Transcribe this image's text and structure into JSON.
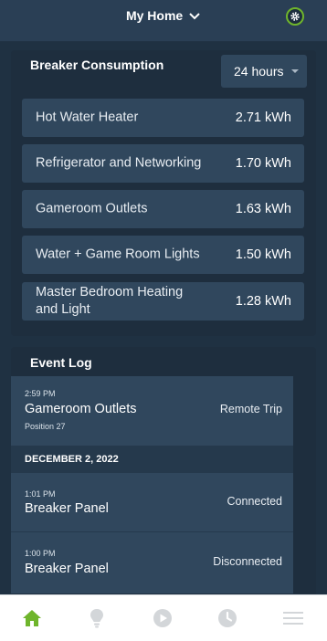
{
  "header": {
    "title": "My Home",
    "title_icon": "chevron-down-icon",
    "settings_icon": "gear-icon"
  },
  "breaker_consumption": {
    "title": "Breaker Consumption",
    "range_selected": "24 hours",
    "rows": [
      {
        "name": "Hot Water Heater",
        "value": "2.71 kWh"
      },
      {
        "name": "Refrigerator and Networking",
        "value": "1.70 kWh"
      },
      {
        "name": "Gameroom Outlets",
        "value": "1.63 kWh"
      },
      {
        "name": "Water + Game Room Lights",
        "value": "1.50 kWh"
      },
      {
        "name": "Master Bedroom Heating and Light",
        "value": "1.28 kWh"
      }
    ]
  },
  "event_log": {
    "title": "Event Log",
    "first_event": {
      "time": "2:59 PM",
      "name": "Gameroom Outlets",
      "sub": "Position 27",
      "status": "Remote Trip"
    },
    "date_header": "DECEMBER 2, 2022",
    "events": [
      {
        "time": "1:01 PM",
        "name": "Breaker Panel",
        "status": "Connected"
      },
      {
        "time": "1:00 PM",
        "name": "Breaker Panel",
        "status": "Disconnected"
      }
    ]
  },
  "tabbar": {
    "items": [
      {
        "icon": "home-icon",
        "active": true
      },
      {
        "icon": "lightbulb-icon",
        "active": false
      },
      {
        "icon": "play-icon",
        "active": false
      },
      {
        "icon": "clock-icon",
        "active": false
      },
      {
        "icon": "menu-icon",
        "active": false
      }
    ]
  },
  "colors": {
    "accent": "#6fb52c",
    "background": "#1f3142",
    "card": "#1e2e3e",
    "row": "#30475d",
    "inactive_tab": "#d3d6d9"
  }
}
